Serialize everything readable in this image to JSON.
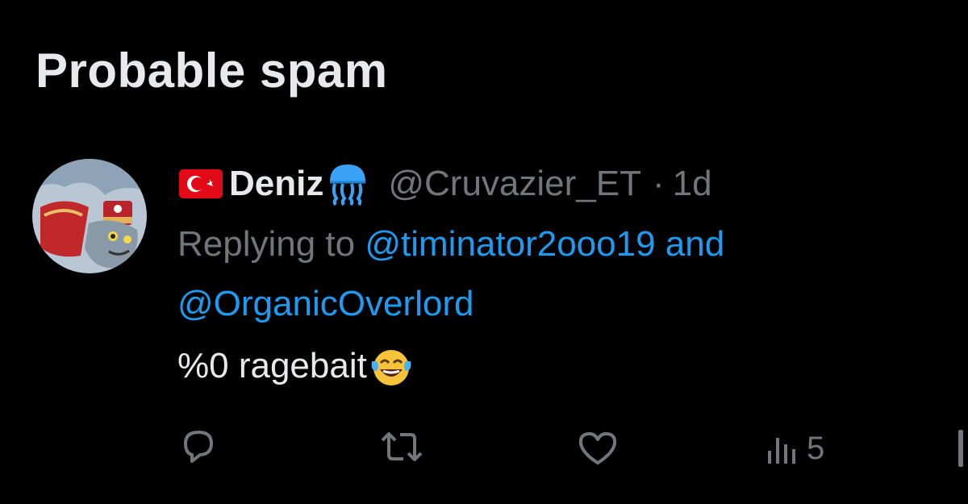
{
  "section": {
    "title": "Probable spam"
  },
  "tweet": {
    "display_name": "Deniz",
    "name_prefix_emoji": "turkish-flag",
    "name_suffix_emoji": "jellyfish",
    "handle": "@Cruvazier_ET",
    "separator": "·",
    "time": "1d",
    "replying_prefix": "Replying to ",
    "replying_to": [
      "@timinator2ooo19",
      "@OrganicOverlord"
    ],
    "replying_join": " and",
    "text": "%0 ragebait",
    "text_suffix_emoji": "face-with-tears-of-joy"
  },
  "actions": {
    "reply_icon": "reply-icon",
    "retweet_icon": "retweet-icon",
    "like_icon": "heart-icon",
    "views_icon": "views-icon",
    "views_count": "5"
  },
  "colors": {
    "background": "#000000",
    "text_primary": "#e7e9ea",
    "text_secondary": "#71767b",
    "accent": "#1d9bf0"
  }
}
